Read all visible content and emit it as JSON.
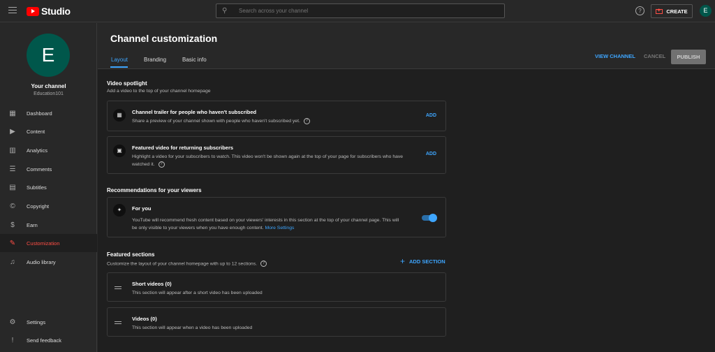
{
  "app": {
    "logo_text": "Studio"
  },
  "search": {
    "placeholder": "Search across your channel"
  },
  "topbar": {
    "help_icon": "?",
    "create_label": "CREATE",
    "avatar_letter": "E"
  },
  "sidebar": {
    "avatar_letter": "E",
    "channel_title": "Your channel",
    "channel_name": "Education101",
    "items": [
      {
        "label": "Dashboard",
        "icon": "▦"
      },
      {
        "label": "Content",
        "icon": "▶"
      },
      {
        "label": "Analytics",
        "icon": "▥"
      },
      {
        "label": "Comments",
        "icon": "☰"
      },
      {
        "label": "Subtitles",
        "icon": "▤"
      },
      {
        "label": "Copyright",
        "icon": "©"
      },
      {
        "label": "Earn",
        "icon": "$"
      },
      {
        "label": "Customization",
        "icon": "✎"
      },
      {
        "label": "Audio library",
        "icon": "♫"
      }
    ],
    "bottom_items": [
      {
        "label": "Settings",
        "icon": "⚙"
      },
      {
        "label": "Send feedback",
        "icon": "!"
      }
    ]
  },
  "header": {
    "title": "Channel customization",
    "tabs": [
      {
        "label": "Layout"
      },
      {
        "label": "Branding"
      },
      {
        "label": "Basic info"
      }
    ],
    "view_channel": "VIEW CHANNEL",
    "cancel": "CANCEL",
    "publish": "PUBLISH"
  },
  "spotlight": {
    "title": "Video spotlight",
    "subtitle": "Add a video to the top of your channel homepage",
    "trailer": {
      "title": "Channel trailer for people who haven't subscribed",
      "desc": "Share a preview of your channel shown with people who haven't subscribed yet.",
      "add": "ADD"
    },
    "featured": {
      "title": "Featured video for returning subscribers",
      "desc_line1": "Highlight a video for your subscribers to watch. This video won't be shown again at the top of your page for subscribers who have",
      "desc_line2": "watched it.",
      "add": "ADD"
    }
  },
  "recommendations": {
    "title": "Recommendations for your viewers",
    "for_you": {
      "title": "For you",
      "desc_line1": "YouTube will recommend fresh content based on your viewers' interests in this section at the top of your channel page. This will",
      "desc_line2": "be only visible to your viewers when you have enough content.",
      "more": "More Settings",
      "enabled": true
    }
  },
  "featured_sections": {
    "title": "Featured sections",
    "subtitle": "Customize the layout of your channel homepage with up to 12 sections.",
    "add_section": "ADD SECTION",
    "sections": [
      {
        "title": "Short videos (0)",
        "desc": "This section will appear after a short video has been uploaded"
      },
      {
        "title": "Videos (0)",
        "desc": "This section will appear when a video has been uploaded"
      }
    ]
  },
  "colors": {
    "accent": "#3ea6ff",
    "active_nav": "#ff4e45",
    "avatar": "#00574b"
  }
}
